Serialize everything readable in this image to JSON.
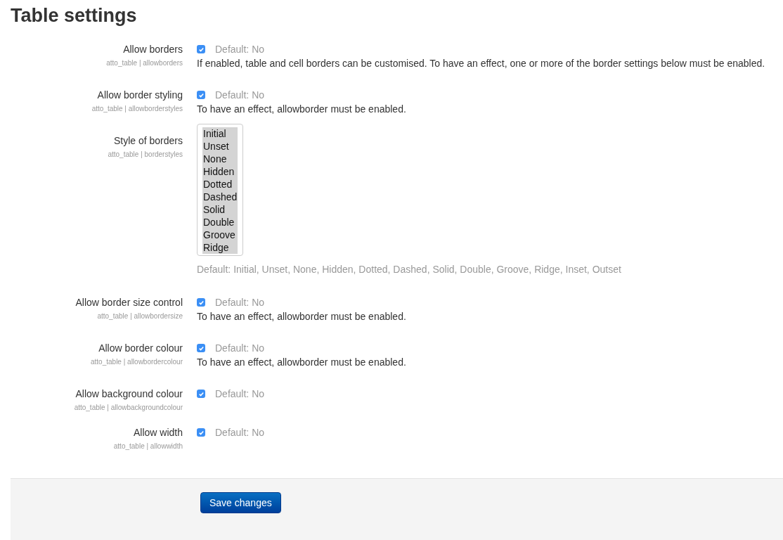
{
  "title": "Table settings",
  "settings": [
    {
      "kind": "checkbox",
      "label": "Allow borders",
      "setting_id": "atto_table | allowborders",
      "checked": true,
      "default": "Default: No",
      "description": "If enabled, table and cell borders can be customised. To have an effect, one or more of the border settings below must be enabled."
    },
    {
      "kind": "checkbox",
      "label": "Allow border styling",
      "setting_id": "atto_table | allowborderstyles",
      "checked": true,
      "default": "Default: No",
      "description": "To have an effect, allowborder must be enabled."
    },
    {
      "kind": "multiselect",
      "label": "Style of borders",
      "setting_id": "atto_table | borderstyles",
      "options": [
        {
          "label": "Initial",
          "selected": true
        },
        {
          "label": "Unset",
          "selected": true
        },
        {
          "label": "None",
          "selected": true
        },
        {
          "label": "Hidden",
          "selected": true
        },
        {
          "label": "Dotted",
          "selected": true
        },
        {
          "label": "Dashed",
          "selected": true
        },
        {
          "label": "Solid",
          "selected": true
        },
        {
          "label": "Double",
          "selected": true
        },
        {
          "label": "Groove",
          "selected": true
        },
        {
          "label": "Ridge",
          "selected": true
        }
      ],
      "default": "Default: Initial, Unset, None, Hidden, Dotted, Dashed, Solid, Double, Groove, Ridge, Inset, Outset"
    },
    {
      "kind": "checkbox",
      "label": "Allow border size control",
      "setting_id": "atto_table | allowbordersize",
      "checked": true,
      "default": "Default: No",
      "description": "To have an effect, allowborder must be enabled."
    },
    {
      "kind": "checkbox",
      "label": "Allow border colour",
      "setting_id": "atto_table | allowbordercolour",
      "checked": true,
      "default": "Default: No",
      "description": "To have an effect, allowborder must be enabled."
    },
    {
      "kind": "checkbox",
      "label": "Allow background colour",
      "setting_id": "atto_table | allowbackgroundcolour",
      "checked": true,
      "default": "Default: No"
    },
    {
      "kind": "checkbox",
      "label": "Allow width",
      "setting_id": "atto_table | allowwidth",
      "checked": true,
      "default": "Default: No"
    }
  ],
  "save_button": "Save changes"
}
